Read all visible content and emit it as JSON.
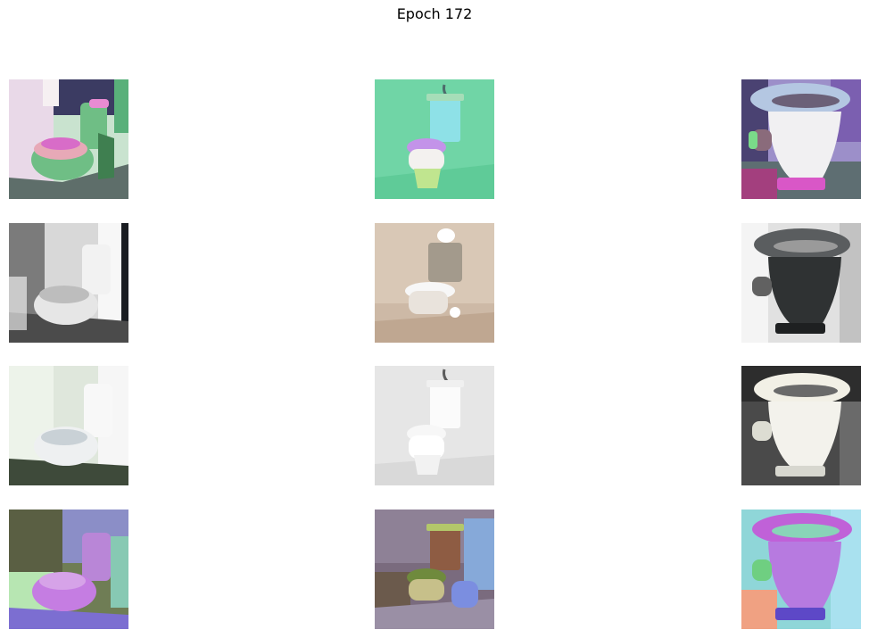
{
  "figure": {
    "title": "Epoch 172"
  },
  "grid": {
    "rows": 4,
    "cols": 3,
    "row_descriptions": [
      "translated-colored",
      "grayscale-source",
      "white-source",
      "translated-colored"
    ],
    "images": [
      {
        "id": "r0c0",
        "subject": "one-piece-toilet",
        "tint": "green-pink"
      },
      {
        "id": "r0c1",
        "subject": "wall-hung-toilet-with-tank",
        "tint": "mint-teal"
      },
      {
        "id": "r0c2",
        "subject": "squat-pan-toilet",
        "tint": "blue-purple"
      },
      {
        "id": "r1c0",
        "subject": "one-piece-toilet",
        "tint": "grayscale"
      },
      {
        "id": "r1c1",
        "subject": "wall-hung-toilet-with-tank",
        "tint": "beige"
      },
      {
        "id": "r1c2",
        "subject": "squat-pan-toilet",
        "tint": "dark-gray"
      },
      {
        "id": "r2c0",
        "subject": "one-piece-toilet",
        "tint": "white-green"
      },
      {
        "id": "r2c1",
        "subject": "wall-hung-toilet-with-tank",
        "tint": "white"
      },
      {
        "id": "r2c2",
        "subject": "squat-pan-toilet",
        "tint": "white-dark"
      },
      {
        "id": "r3c0",
        "subject": "one-piece-toilet",
        "tint": "psychedelic"
      },
      {
        "id": "r3c1",
        "subject": "wall-hung-toilet-with-tank",
        "tint": "psychedelic"
      },
      {
        "id": "r3c2",
        "subject": "squat-pan-toilet",
        "tint": "psychedelic"
      }
    ]
  }
}
